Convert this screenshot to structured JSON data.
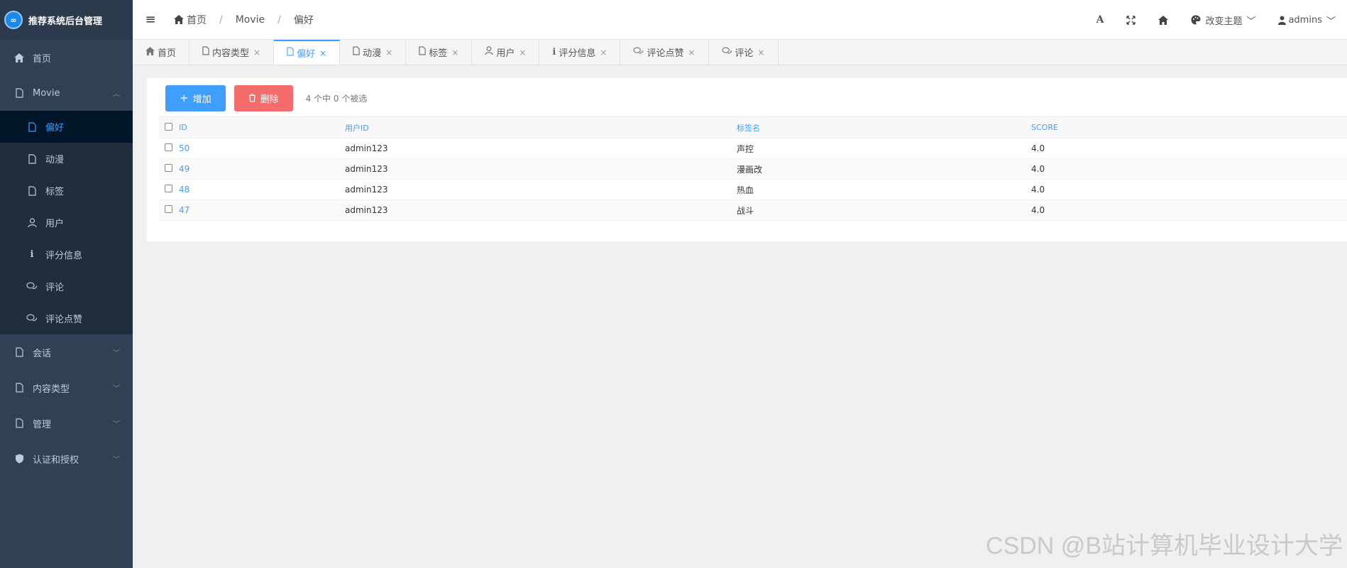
{
  "sidebar": {
    "title": "推荐系统后台管理",
    "items": [
      {
        "label": "首页"
      },
      {
        "label": "Movie",
        "submenu": [
          {
            "label": "偏好"
          },
          {
            "label": "动漫"
          },
          {
            "label": "标签"
          },
          {
            "label": "用户"
          },
          {
            "label": "评分信息"
          },
          {
            "label": "评论"
          },
          {
            "label": "评论点赞"
          }
        ]
      },
      {
        "label": "会话"
      },
      {
        "label": "内容类型"
      },
      {
        "label": "管理"
      },
      {
        "label": "认证和授权"
      }
    ]
  },
  "header": {
    "breadcrumb": [
      "首页",
      "Movie",
      "偏好"
    ],
    "font_icon": "A",
    "theme_label": "改变主题",
    "user_label": "admins"
  },
  "tabs": [
    {
      "label": "首页",
      "icon": "home-icon",
      "closable": false
    },
    {
      "label": "内容类型",
      "icon": "file-icon",
      "closable": true
    },
    {
      "label": "偏好",
      "icon": "file-icon",
      "closable": true,
      "active": true
    },
    {
      "label": "动漫",
      "icon": "file-icon",
      "closable": true
    },
    {
      "label": "标签",
      "icon": "file-icon",
      "closable": true
    },
    {
      "label": "用户",
      "icon": "user-icon",
      "closable": true
    },
    {
      "label": "评分信息",
      "icon": "info-icon",
      "closable": true
    },
    {
      "label": "评论点赞",
      "icon": "comment-icon",
      "closable": true
    },
    {
      "label": "评论",
      "icon": "comment-icon",
      "closable": true
    }
  ],
  "toolbar": {
    "add_label": "增加",
    "delete_label": "删除",
    "selection_info": "4 个中 0 个被选"
  },
  "table": {
    "headers": [
      "ID",
      "用户ID",
      "标签名",
      "SCORE"
    ],
    "rows": [
      {
        "id": "50",
        "user": "admin123",
        "tag": "声控",
        "score": "4.0"
      },
      {
        "id": "49",
        "user": "admin123",
        "tag": "漫画改",
        "score": "4.0"
      },
      {
        "id": "48",
        "user": "admin123",
        "tag": "热血",
        "score": "4.0"
      },
      {
        "id": "47",
        "user": "admin123",
        "tag": "战斗",
        "score": "4.0"
      }
    ]
  },
  "watermark": "CSDN @B站计算机毕业设计大学",
  "colors": {
    "sidebar_bg": "#304156",
    "accent": "#409eff",
    "danger": "#f56c6c"
  }
}
